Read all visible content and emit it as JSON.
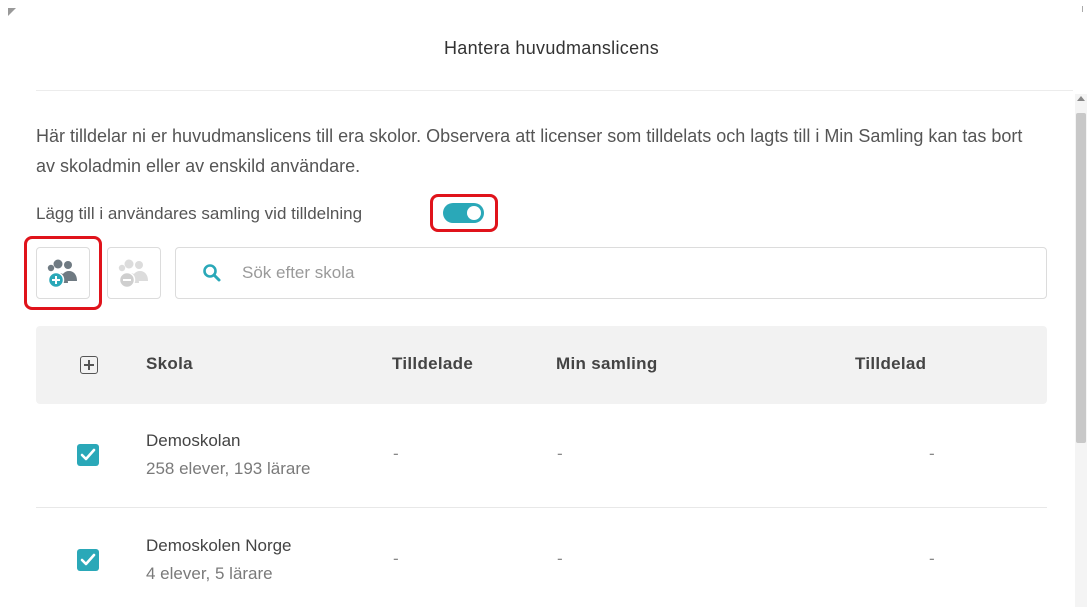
{
  "dialog": {
    "title": "Hantera huvudmanslicens",
    "description": "Här tilldelar ni er huvudmanslicens till era skolor. Observera att licenser som tilldelats och lagts till i Min Samling kan tas bort av skoladmin eller av enskild användare.",
    "toggle_label": "Lägg till i användares samling vid tilldelning",
    "toggle_on": true
  },
  "toolbar": {
    "add_icon": "add-group-icon",
    "remove_icon": "remove-group-icon",
    "search_placeholder": "Sök efter skola"
  },
  "table": {
    "headers": {
      "expand_icon": "expand-all-icon",
      "school": "Skola",
      "assigned": "Tilldelade",
      "collection": "Min samling",
      "assigned_to": "Tilldelad"
    },
    "rows": [
      {
        "name": "Demoskolan",
        "sub": "258 elever, 193 lärare",
        "assigned": "-",
        "collection": "-",
        "assigned_to": "-",
        "checked": true
      },
      {
        "name": "Demoskolen Norge",
        "sub": "4 elever, 5 lärare",
        "assigned": "-",
        "collection": "-",
        "assigned_to": "-",
        "checked": true
      }
    ]
  },
  "colors": {
    "accent": "#2aa8b8",
    "highlight": "#e0131b"
  }
}
